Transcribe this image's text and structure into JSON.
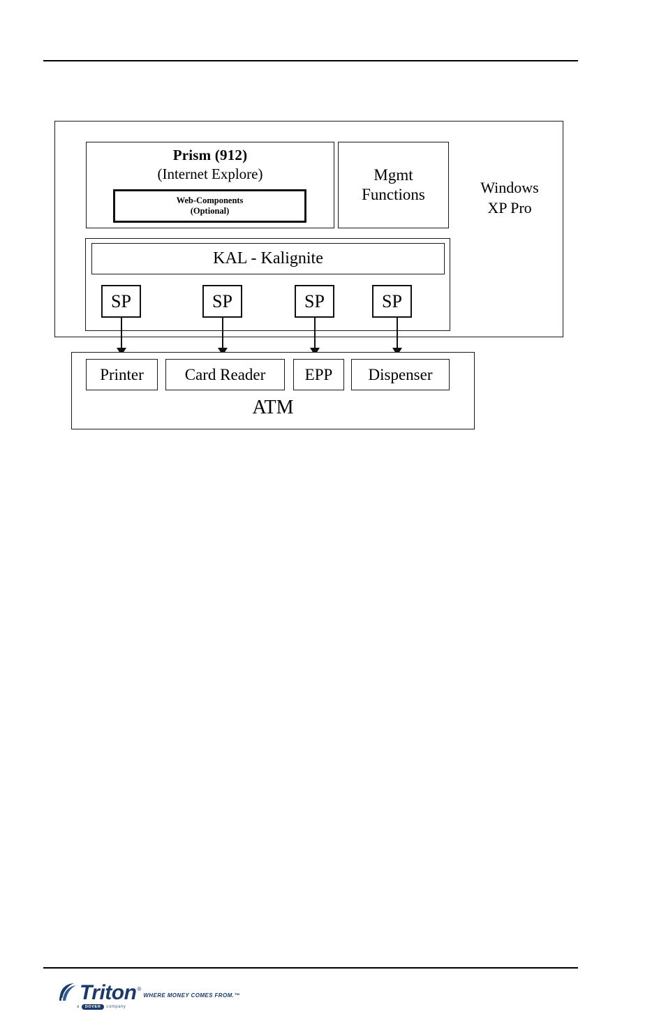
{
  "page": {
    "rules": {
      "top_label": "header-rule",
      "bottom_label": "footer-rule"
    }
  },
  "diagram": {
    "os": {
      "platform_label_line1": "Windows",
      "platform_label_line2": "XP Pro"
    },
    "prism": {
      "title": "Prism (912)",
      "subtitle": "(Internet Explore)",
      "web_components": {
        "line1": "Web-Components",
        "line2": "(Optional)"
      }
    },
    "mgmt": {
      "line1": "Mgmt",
      "line2": "Functions"
    },
    "kal": {
      "label": "KAL - Kalignite"
    },
    "service_providers": [
      {
        "label": "SP"
      },
      {
        "label": "SP"
      },
      {
        "label": "SP"
      },
      {
        "label": "SP"
      }
    ],
    "atm": {
      "label": "ATM",
      "devices": [
        {
          "label": "Printer"
        },
        {
          "label": "Card Reader"
        },
        {
          "label": "EPP"
        },
        {
          "label": "Dispenser"
        }
      ]
    }
  },
  "footer": {
    "brand": "Triton",
    "registered_mark": "®",
    "tagline": "WHERE MONEY COMES FROM.™",
    "sub_prefix": "a",
    "sub_badge": "DOVER",
    "sub_suffix": "company",
    "brand_color": "#1B3A6B"
  }
}
